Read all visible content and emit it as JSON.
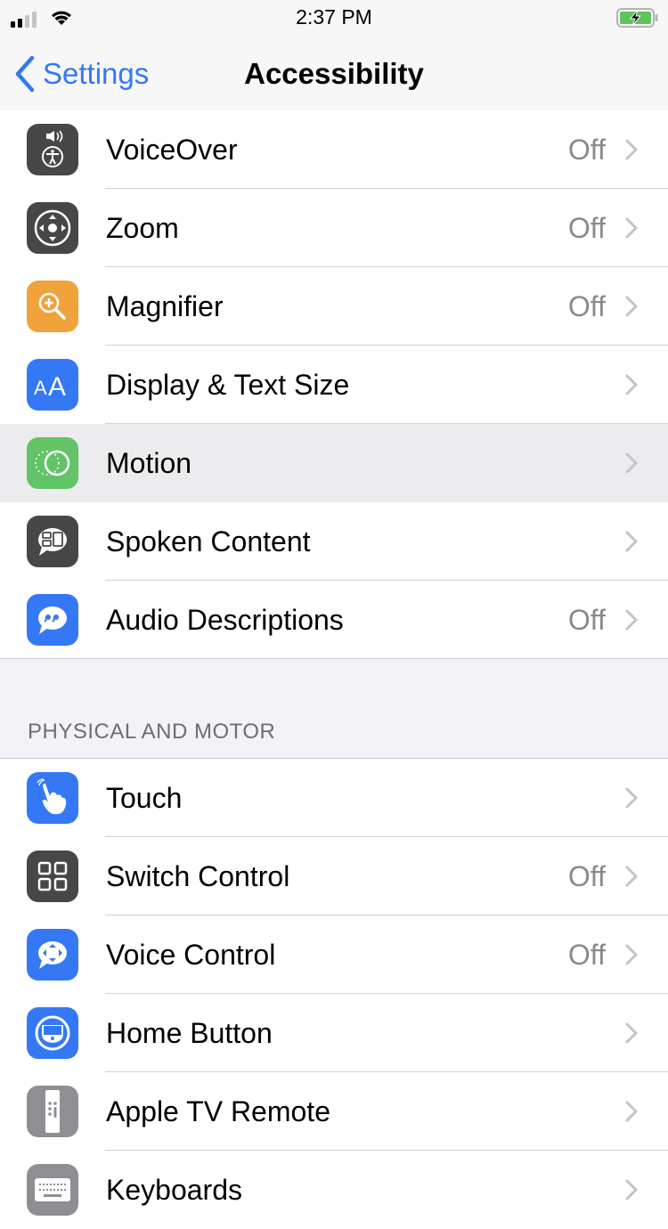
{
  "status_bar": {
    "time": "2:37 PM",
    "signal_bars": 2,
    "signal_total": 4,
    "battery_charging": true
  },
  "nav": {
    "back_label": "Settings",
    "title": "Accessibility"
  },
  "colors": {
    "accent": "#3478f6",
    "dark_icon": "#474747",
    "orange": "#f0a23b",
    "blue_icon": "#3478f6",
    "green": "#62c466",
    "gray_icon": "#8e8e93"
  },
  "vision_items": [
    {
      "label": "VoiceOver",
      "value": "Off",
      "icon": "voiceover-icon"
    },
    {
      "label": "Zoom",
      "value": "Off",
      "icon": "zoom-icon"
    },
    {
      "label": "Magnifier",
      "value": "Off",
      "icon": "magnifier-icon"
    },
    {
      "label": "Display & Text Size",
      "value": "",
      "icon": "display-text-size-icon"
    },
    {
      "label": "Motion",
      "value": "",
      "icon": "motion-icon"
    },
    {
      "label": "Spoken Content",
      "value": "",
      "icon": "spoken-content-icon"
    },
    {
      "label": "Audio Descriptions",
      "value": "Off",
      "icon": "audio-descriptions-icon"
    }
  ],
  "physical_section": {
    "header": "PHYSICAL AND MOTOR",
    "items": [
      {
        "label": "Touch",
        "value": "",
        "icon": "touch-icon"
      },
      {
        "label": "Switch Control",
        "value": "Off",
        "icon": "switch-control-icon"
      },
      {
        "label": "Voice Control",
        "value": "Off",
        "icon": "voice-control-icon"
      },
      {
        "label": "Home Button",
        "value": "",
        "icon": "home-button-icon"
      },
      {
        "label": "Apple TV Remote",
        "value": "",
        "icon": "apple-tv-remote-icon"
      },
      {
        "label": "Keyboards",
        "value": "",
        "icon": "keyboard-icon"
      }
    ]
  }
}
